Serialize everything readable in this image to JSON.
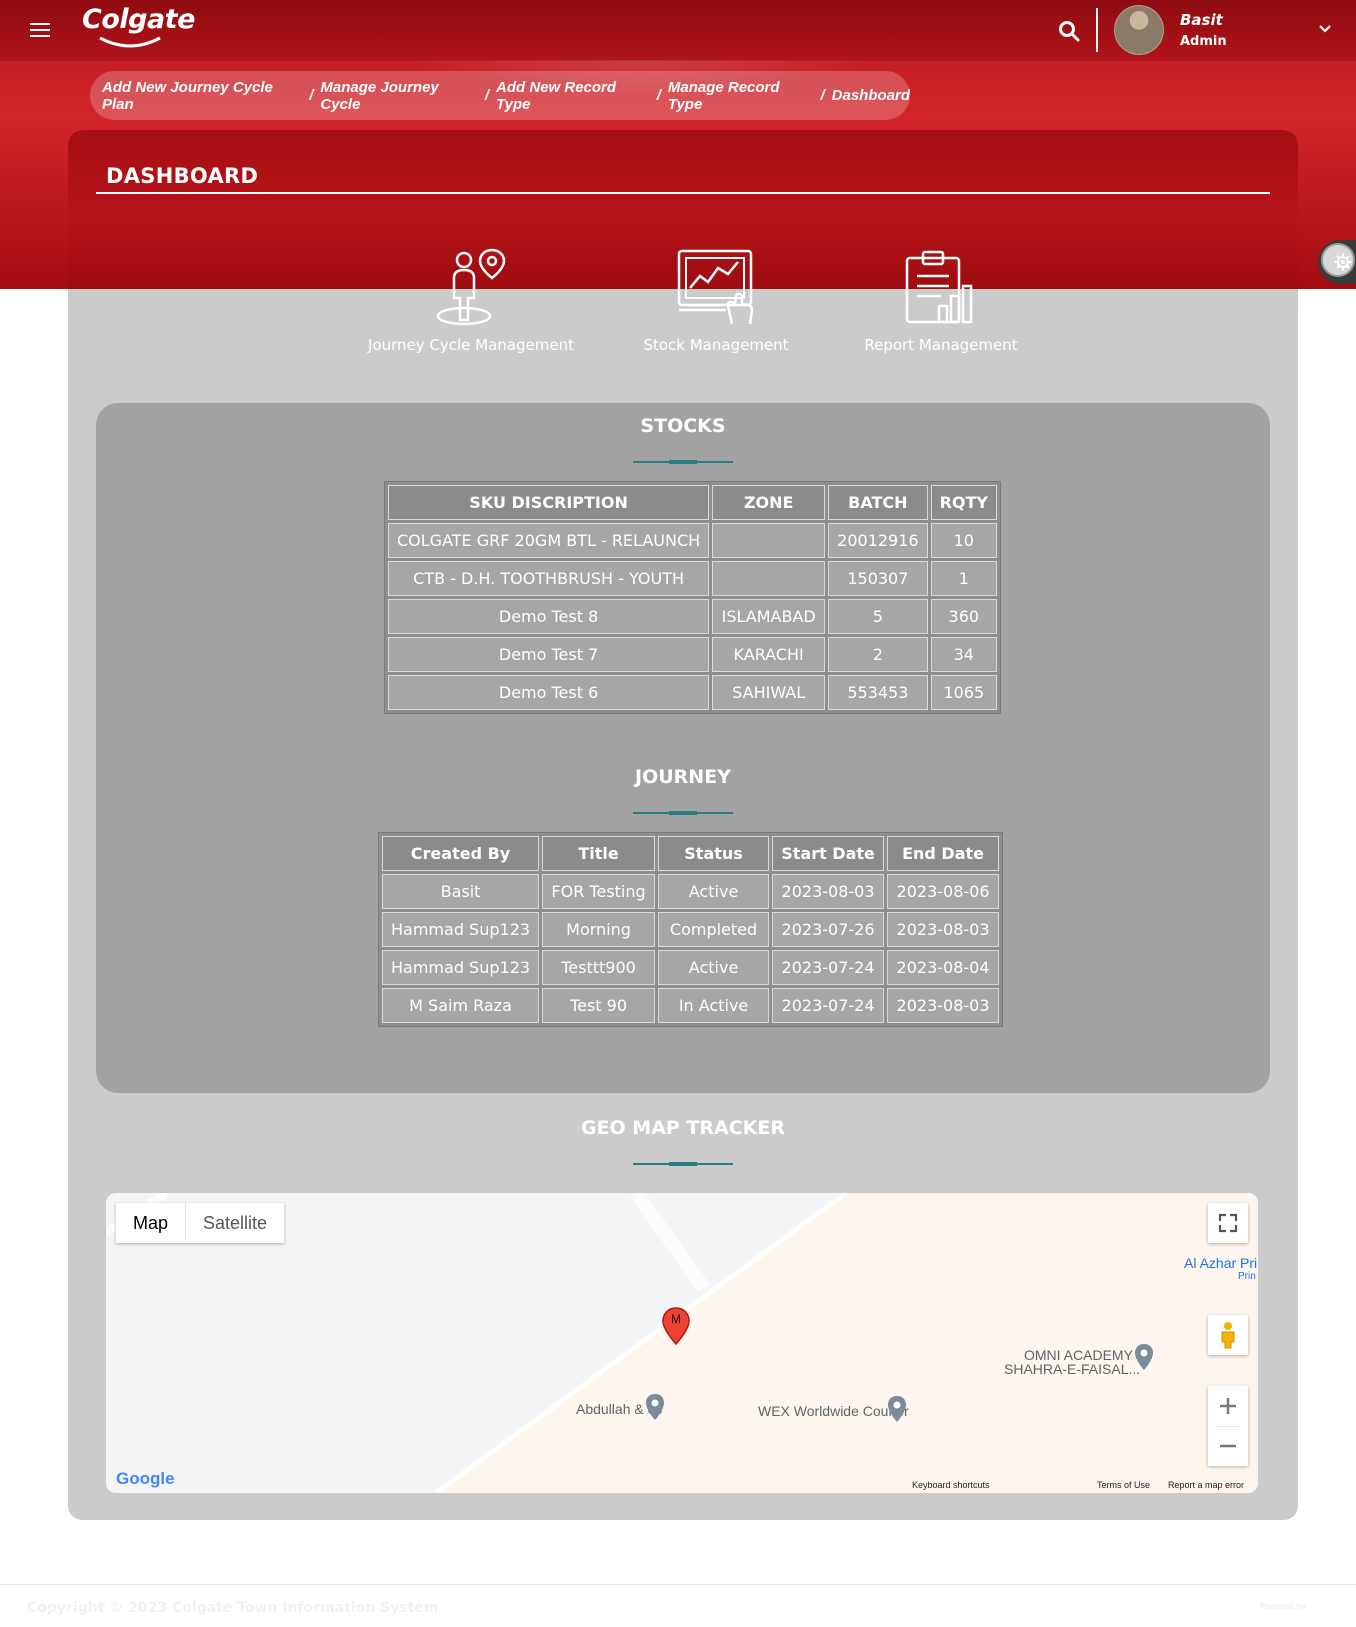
{
  "header": {
    "brand": "Colgate",
    "user": {
      "name": "Basit",
      "role": "Admin"
    }
  },
  "breadcrumb": [
    "Add New Journey Cycle Plan",
    "Manage Journey Cycle",
    "Add New Record Type",
    "Manage Record Type",
    "Dashboard"
  ],
  "page": {
    "title": "DASHBOARD",
    "modules": [
      {
        "label": "Journey Cycle Management",
        "icon": "journey-person-pin-icon"
      },
      {
        "label": "Stock Management",
        "icon": "stock-chart-touch-icon"
      },
      {
        "label": "Report Management",
        "icon": "report-clipboard-chart-icon"
      }
    ]
  },
  "stocks": {
    "title": "STOCKS",
    "columns": [
      "SKU DISCRIPTION",
      "ZONE",
      "BATCH",
      "RQTY"
    ],
    "rows": [
      [
        "COLGATE GRF 20GM BTL - RELAUNCH",
        "",
        "20012916",
        "10"
      ],
      [
        "CTB - D.H. TOOTHBRUSH - YOUTH",
        "",
        "150307",
        "1"
      ],
      [
        "Demo Test 8",
        "ISLAMABAD",
        "5",
        "360"
      ],
      [
        "Demo Test 7",
        "KARACHI",
        "2",
        "34"
      ],
      [
        "Demo Test 6",
        "SAHIWAL",
        "553453",
        "1065"
      ]
    ]
  },
  "journey": {
    "title": "JOURNEY",
    "columns": [
      "Created By",
      "Title",
      "Status",
      "Start Date",
      "End Date"
    ],
    "rows": [
      [
        "Basit",
        "FOR Testing",
        "Active",
        "2023-08-03",
        "2023-08-06"
      ],
      [
        "Hammad Sup123",
        "Morning",
        "Completed",
        "2023-07-26",
        "2023-08-03"
      ],
      [
        "Hammad Sup123",
        "Testtt900",
        "Active",
        "2023-07-24",
        "2023-08-04"
      ],
      [
        "M Saim Raza",
        "Test 90",
        "In Active",
        "2023-07-24",
        "2023-08-03"
      ]
    ]
  },
  "geo": {
    "title": "GEO MAP TRACKER",
    "map_type": {
      "map": "Map",
      "satellite": "Satellite"
    },
    "marker_label": "M",
    "pois": {
      "abdullah": "Abdullah & co",
      "wex": "WEX Worldwide Courier",
      "omni_line1": "OMNI ACADEMY",
      "omni_line2": "SHAHRA-E-FAISAL...",
      "al_azhar": "Al Azhar Pri",
      "al_azhar_sub": "Prin"
    },
    "google": "Google",
    "footer": {
      "shortcuts": "Keyboard shortcuts",
      "terms": "Terms of Use",
      "report": "Report a map error"
    }
  },
  "footer": {
    "copyright": "Copyright © 2023 Colgate Town Information System",
    "powered_by": "Powered by"
  },
  "colors": {
    "brand_red": "#b4161c",
    "card_gray": "#cbcbcb",
    "table_box_gray": "#a2a2a2",
    "accent_teal": "#2c7d80",
    "marker_red": "#ea4335"
  }
}
